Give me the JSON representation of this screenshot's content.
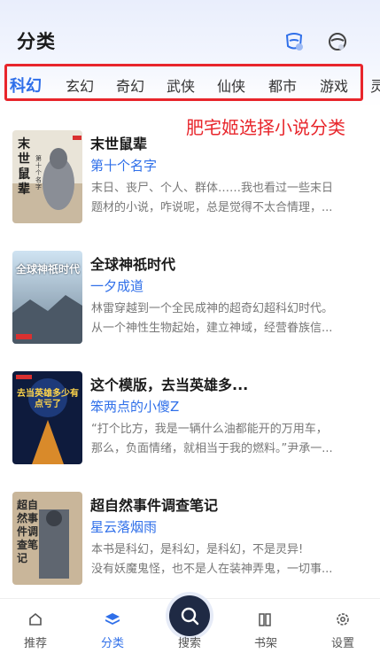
{
  "header": {
    "title": "分类",
    "icons": [
      "shield-icon",
      "face-icon"
    ]
  },
  "tabs": [
    {
      "label": "科幻",
      "active": true
    },
    {
      "label": "玄幻",
      "active": false
    },
    {
      "label": "奇幻",
      "active": false
    },
    {
      "label": "武侠",
      "active": false
    },
    {
      "label": "仙侠",
      "active": false
    },
    {
      "label": "都市",
      "active": false
    },
    {
      "label": "游戏",
      "active": false
    },
    {
      "label": "灵",
      "active": false
    }
  ],
  "annotation": "肥宅姬选择小说分类",
  "books": [
    {
      "title": "末世鼠辈",
      "author": "第十个名字",
      "desc1": "末日、丧尸、个人、群体……我也看过一些末日",
      "desc2": "题材的小说，咋说呢，总是觉得不太合情理，...",
      "cover_text": "末世鼠辈",
      "cover_sub": "第十个名字"
    },
    {
      "title": "全球神祇时代",
      "author": "一夕成道",
      "desc1": "林雷穿越到一个全民成神的超奇幻超科幻时代。",
      "desc2": "从一个神性生物起始，建立神域，经营眷族信...",
      "cover_text": "全球神祇时代"
    },
    {
      "title": "这个模版，去当英雄多...",
      "author": "笨两点的小傻Z",
      "desc1": "“打个比方，我是一辆什么油都能开的万用车，",
      "desc2": "那么，负面情绪，就相当于我的燃料。”尹承一...",
      "cover_text": "去当英雄多少有点亏了"
    },
    {
      "title": "超自然事件调查笔记",
      "author": "星云落烟雨",
      "desc1": "本书是科幻，是科幻，是科幻，不是灵异!",
      "desc2": "没有妖魔鬼怪，也不是人在装神弄鬼，一切事...",
      "cover_text": "超自然事件调查笔记"
    }
  ],
  "nav": [
    {
      "label": "推荐",
      "icon": "home-icon",
      "active": false
    },
    {
      "label": "分类",
      "icon": "layers-icon",
      "active": true
    },
    {
      "label": "搜索",
      "icon": "search-icon",
      "active": false
    },
    {
      "label": "书架",
      "icon": "bookshelf-icon",
      "active": false
    },
    {
      "label": "设置",
      "icon": "gear-icon",
      "active": false
    }
  ],
  "colors": {
    "accent": "#2f6fe9",
    "annotation": "#e8252b"
  }
}
